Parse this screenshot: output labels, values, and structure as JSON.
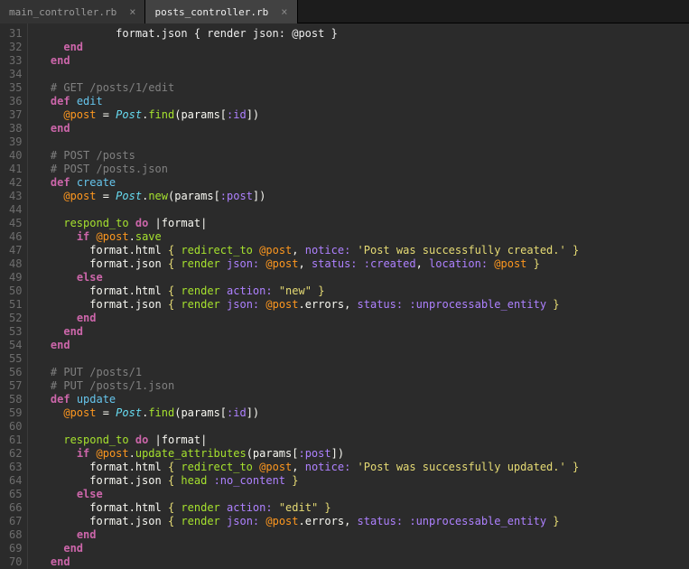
{
  "tabs": [
    {
      "label": "main_controller.rb",
      "active": false
    },
    {
      "label": "posts_controller.rb",
      "active": true
    }
  ],
  "lineStart": 31,
  "lineEnd": 70,
  "code": {
    "31": [
      [
        6,
        "plain",
        "      format.json { render json: @post }"
      ]
    ],
    "32": [
      [
        4,
        "kw",
        "end"
      ]
    ],
    "33": [
      [
        2,
        "kw",
        "end"
      ]
    ],
    "34": [],
    "35": [
      [
        2,
        "cmt",
        "# GET /posts/1/edit"
      ]
    ],
    "36": [
      [
        2,
        "kw",
        "def "
      ],
      [
        0,
        "def",
        "edit"
      ]
    ],
    "37": [
      [
        4,
        "var",
        "@post"
      ],
      [
        0,
        "op",
        " = "
      ],
      [
        0,
        "cls",
        "Post"
      ],
      [
        0,
        "op",
        "."
      ],
      [
        0,
        "fn",
        "find"
      ],
      [
        0,
        "op",
        "(params["
      ],
      [
        0,
        "sym",
        ":id"
      ],
      [
        0,
        "op",
        "])"
      ]
    ],
    "38": [
      [
        2,
        "kw",
        "end"
      ]
    ],
    "39": [],
    "40": [
      [
        2,
        "cmt",
        "# POST /posts"
      ]
    ],
    "41": [
      [
        2,
        "cmt",
        "# POST /posts.json"
      ]
    ],
    "42": [
      [
        2,
        "kw",
        "def "
      ],
      [
        0,
        "def",
        "create"
      ]
    ],
    "43": [
      [
        4,
        "var",
        "@post"
      ],
      [
        0,
        "op",
        " = "
      ],
      [
        0,
        "cls",
        "Post"
      ],
      [
        0,
        "op",
        "."
      ],
      [
        0,
        "fn",
        "new"
      ],
      [
        0,
        "op",
        "(params["
      ],
      [
        0,
        "sym",
        ":post"
      ],
      [
        0,
        "op",
        "])"
      ]
    ],
    "44": [],
    "45": [
      [
        4,
        "fn",
        "respond_to"
      ],
      [
        0,
        "op",
        " "
      ],
      [
        0,
        "kw",
        "do"
      ],
      [
        0,
        "op",
        " |format|"
      ]
    ],
    "46": [
      [
        6,
        "kw",
        "if "
      ],
      [
        0,
        "var",
        "@post"
      ],
      [
        0,
        "op",
        "."
      ],
      [
        0,
        "fn",
        "save"
      ]
    ],
    "47": [
      [
        8,
        "op",
        "format.html "
      ],
      [
        0,
        "brace",
        "{"
      ],
      [
        0,
        "op",
        " "
      ],
      [
        0,
        "fn",
        "redirect_to"
      ],
      [
        0,
        "op",
        " "
      ],
      [
        0,
        "var",
        "@post"
      ],
      [
        0,
        "op",
        ", "
      ],
      [
        0,
        "sym",
        "notice:"
      ],
      [
        0,
        "op",
        " "
      ],
      [
        0,
        "str",
        "'Post was successfully created.'"
      ],
      [
        0,
        "op",
        " "
      ],
      [
        0,
        "brace",
        "}"
      ]
    ],
    "48": [
      [
        8,
        "op",
        "format.json "
      ],
      [
        0,
        "brace",
        "{"
      ],
      [
        0,
        "op",
        " "
      ],
      [
        0,
        "fn",
        "render"
      ],
      [
        0,
        "op",
        " "
      ],
      [
        0,
        "sym",
        "json:"
      ],
      [
        0,
        "op",
        " "
      ],
      [
        0,
        "var",
        "@post"
      ],
      [
        0,
        "op",
        ", "
      ],
      [
        0,
        "sym",
        "status:"
      ],
      [
        0,
        "op",
        " "
      ],
      [
        0,
        "sym",
        ":created"
      ],
      [
        0,
        "op",
        ", "
      ],
      [
        0,
        "sym",
        "location:"
      ],
      [
        0,
        "op",
        " "
      ],
      [
        0,
        "var",
        "@post"
      ],
      [
        0,
        "op",
        " "
      ],
      [
        0,
        "brace",
        "}"
      ]
    ],
    "49": [
      [
        6,
        "kw",
        "else"
      ]
    ],
    "50": [
      [
        8,
        "op",
        "format.html "
      ],
      [
        0,
        "brace",
        "{"
      ],
      [
        0,
        "op",
        " "
      ],
      [
        0,
        "fn",
        "render"
      ],
      [
        0,
        "op",
        " "
      ],
      [
        0,
        "sym",
        "action:"
      ],
      [
        0,
        "op",
        " "
      ],
      [
        0,
        "str",
        "\"new\""
      ],
      [
        0,
        "op",
        " "
      ],
      [
        0,
        "brace",
        "}"
      ]
    ],
    "51": [
      [
        8,
        "op",
        "format.json "
      ],
      [
        0,
        "brace",
        "{"
      ],
      [
        0,
        "op",
        " "
      ],
      [
        0,
        "fn",
        "render"
      ],
      [
        0,
        "op",
        " "
      ],
      [
        0,
        "sym",
        "json:"
      ],
      [
        0,
        "op",
        " "
      ],
      [
        0,
        "var",
        "@post"
      ],
      [
        0,
        "op",
        ".errors, "
      ],
      [
        0,
        "sym",
        "status:"
      ],
      [
        0,
        "op",
        " "
      ],
      [
        0,
        "sym",
        ":unprocessable_entity"
      ],
      [
        0,
        "op",
        " "
      ],
      [
        0,
        "brace",
        "}"
      ]
    ],
    "52": [
      [
        6,
        "kw",
        "end"
      ]
    ],
    "53": [
      [
        4,
        "kw",
        "end"
      ]
    ],
    "54": [
      [
        2,
        "kw",
        "end"
      ]
    ],
    "55": [],
    "56": [
      [
        2,
        "cmt",
        "# PUT /posts/1"
      ]
    ],
    "57": [
      [
        2,
        "cmt",
        "# PUT /posts/1.json"
      ]
    ],
    "58": [
      [
        2,
        "kw",
        "def "
      ],
      [
        0,
        "def",
        "update"
      ]
    ],
    "59": [
      [
        4,
        "var",
        "@post"
      ],
      [
        0,
        "op",
        " = "
      ],
      [
        0,
        "cls",
        "Post"
      ],
      [
        0,
        "op",
        "."
      ],
      [
        0,
        "fn",
        "find"
      ],
      [
        0,
        "op",
        "(params["
      ],
      [
        0,
        "sym",
        ":id"
      ],
      [
        0,
        "op",
        "])"
      ]
    ],
    "60": [],
    "61": [
      [
        4,
        "fn",
        "respond_to"
      ],
      [
        0,
        "op",
        " "
      ],
      [
        0,
        "kw",
        "do"
      ],
      [
        0,
        "op",
        " |format|"
      ]
    ],
    "62": [
      [
        6,
        "kw",
        "if "
      ],
      [
        0,
        "var",
        "@post"
      ],
      [
        0,
        "op",
        "."
      ],
      [
        0,
        "fn",
        "update_attributes"
      ],
      [
        0,
        "op",
        "(params["
      ],
      [
        0,
        "sym",
        ":post"
      ],
      [
        0,
        "op",
        "])"
      ]
    ],
    "63": [
      [
        8,
        "op",
        "format.html "
      ],
      [
        0,
        "brace",
        "{"
      ],
      [
        0,
        "op",
        " "
      ],
      [
        0,
        "fn",
        "redirect_to"
      ],
      [
        0,
        "op",
        " "
      ],
      [
        0,
        "var",
        "@post"
      ],
      [
        0,
        "op",
        ", "
      ],
      [
        0,
        "sym",
        "notice:"
      ],
      [
        0,
        "op",
        " "
      ],
      [
        0,
        "str",
        "'Post was successfully updated.'"
      ],
      [
        0,
        "op",
        " "
      ],
      [
        0,
        "brace",
        "}"
      ]
    ],
    "64": [
      [
        8,
        "op",
        "format.json "
      ],
      [
        0,
        "brace",
        "{"
      ],
      [
        0,
        "op",
        " "
      ],
      [
        0,
        "fn",
        "head"
      ],
      [
        0,
        "op",
        " "
      ],
      [
        0,
        "sym",
        ":no_content"
      ],
      [
        0,
        "op",
        " "
      ],
      [
        0,
        "brace",
        "}"
      ]
    ],
    "65": [
      [
        6,
        "kw",
        "else"
      ]
    ],
    "66": [
      [
        8,
        "op",
        "format.html "
      ],
      [
        0,
        "brace",
        "{"
      ],
      [
        0,
        "op",
        " "
      ],
      [
        0,
        "fn",
        "render"
      ],
      [
        0,
        "op",
        " "
      ],
      [
        0,
        "sym",
        "action:"
      ],
      [
        0,
        "op",
        " "
      ],
      [
        0,
        "str",
        "\"edit\""
      ],
      [
        0,
        "op",
        " "
      ],
      [
        0,
        "brace",
        "}"
      ]
    ],
    "67": [
      [
        8,
        "op",
        "format.json "
      ],
      [
        0,
        "brace",
        "{"
      ],
      [
        0,
        "op",
        " "
      ],
      [
        0,
        "fn",
        "render"
      ],
      [
        0,
        "op",
        " "
      ],
      [
        0,
        "sym",
        "json:"
      ],
      [
        0,
        "op",
        " "
      ],
      [
        0,
        "var",
        "@post"
      ],
      [
        0,
        "op",
        ".errors, "
      ],
      [
        0,
        "sym",
        "status:"
      ],
      [
        0,
        "op",
        " "
      ],
      [
        0,
        "sym",
        ":unprocessable_entity"
      ],
      [
        0,
        "op",
        " "
      ],
      [
        0,
        "brace",
        "}"
      ]
    ],
    "68": [
      [
        6,
        "kw",
        "end"
      ]
    ],
    "69": [
      [
        4,
        "kw",
        "end"
      ]
    ],
    "70": [
      [
        2,
        "kw",
        "end"
      ]
    ]
  }
}
